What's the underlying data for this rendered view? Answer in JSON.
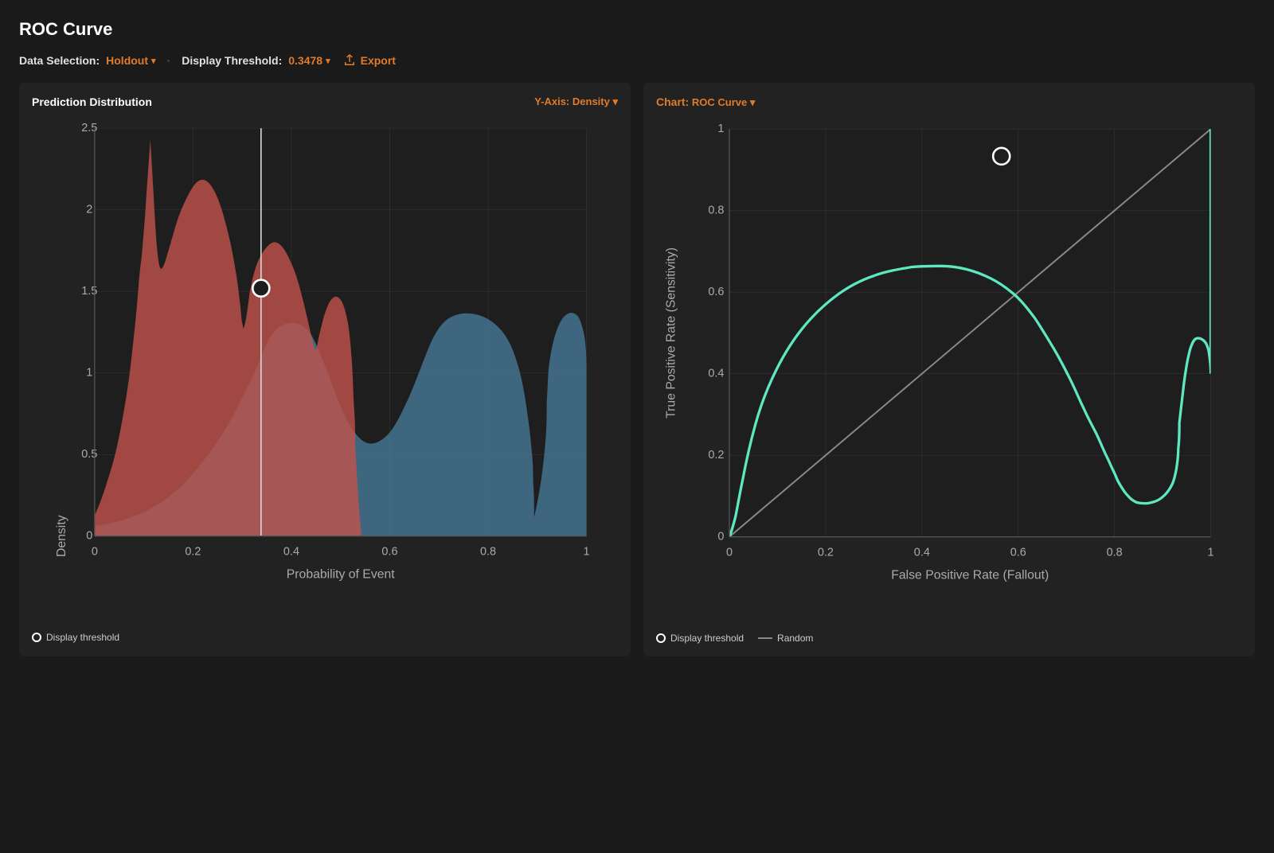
{
  "page": {
    "title": "ROC Curve"
  },
  "toolbar": {
    "data_selection_label": "Data Selection:",
    "data_selection_value": "Holdout",
    "display_threshold_label": "Display Threshold:",
    "display_threshold_value": "0.3478",
    "export_label": "Export"
  },
  "left_chart": {
    "title": "Prediction Distribution",
    "yaxis_label": "Y-Axis:",
    "yaxis_value": "Density",
    "x_label": "Probability of Event",
    "y_label": "Density",
    "threshold": 0.3478,
    "threshold_y": 1.68,
    "legend": {
      "threshold_label": "Display threshold"
    }
  },
  "right_chart": {
    "title": "Chart:",
    "chart_value": "ROC Curve",
    "x_label": "False Positive Rate (Fallout)",
    "y_label": "True Positive Rate (Sensitivity)",
    "threshold_x": 0.565,
    "threshold_y": 0.935,
    "legend": {
      "threshold_label": "Display threshold",
      "random_label": "Random"
    }
  },
  "colors": {
    "orange": "#e07b2a",
    "background": "#1a1a1a",
    "panel": "#222222",
    "red_dist": "#c0524a",
    "blue_dist": "#4a7fa0",
    "roc_curve": "#5de8c1",
    "grid": "#333333",
    "axis": "#555555"
  }
}
